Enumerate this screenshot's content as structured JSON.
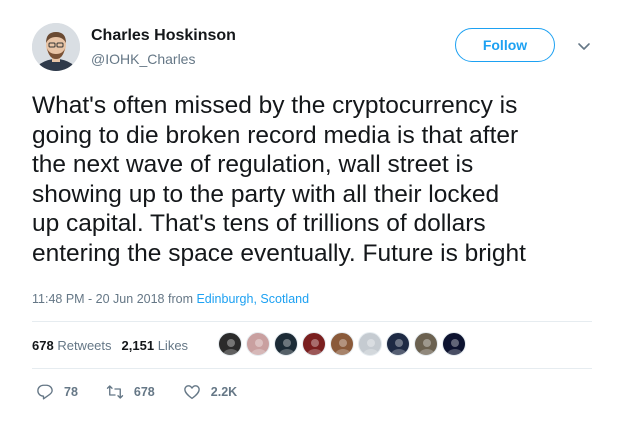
{
  "author": {
    "name": "Charles Hoskinson",
    "handle": "@IOHK_Charles"
  },
  "follow_label": "Follow",
  "tweet": {
    "text": "What's often missed by the cryptocurrency is\ngoing to die broken record media is that after\nthe next wave of regulation, wall street is\nshowing up to the party with all their locked\nup capital. That's tens of trillions of dollars\nentering the space eventually. Future is bright"
  },
  "meta": {
    "timestamp": "11:48 PM - 20 Jun 2018",
    "from_label": "from",
    "location": "Edinburgh, Scotland"
  },
  "stats": {
    "retweets_count": "678",
    "retweets_label": "Retweets",
    "likes_count": "2,151",
    "likes_label": "Likes"
  },
  "likers": [
    {
      "name": "liker-1",
      "color": "#2b2b2b"
    },
    {
      "name": "liker-2",
      "color": "#c9a0a0"
    },
    {
      "name": "liker-3",
      "color": "#1c2b36"
    },
    {
      "name": "liker-4",
      "color": "#7a1f1f"
    },
    {
      "name": "liker-5",
      "color": "#8a5a3a"
    },
    {
      "name": "liker-6",
      "color": "#c5cbd1"
    },
    {
      "name": "liker-7",
      "color": "#1e2a44"
    },
    {
      "name": "liker-8",
      "color": "#6b6150"
    },
    {
      "name": "liker-9",
      "color": "#0d1330"
    }
  ],
  "actions": {
    "replies": "78",
    "retweets": "678",
    "likes": "2.2K"
  },
  "colors": {
    "accent": "#1da1f2",
    "muted": "#657786",
    "text": "#14171a"
  },
  "icons": [
    "reply-icon",
    "retweet-icon",
    "heart-icon",
    "chevron-down-icon"
  ]
}
